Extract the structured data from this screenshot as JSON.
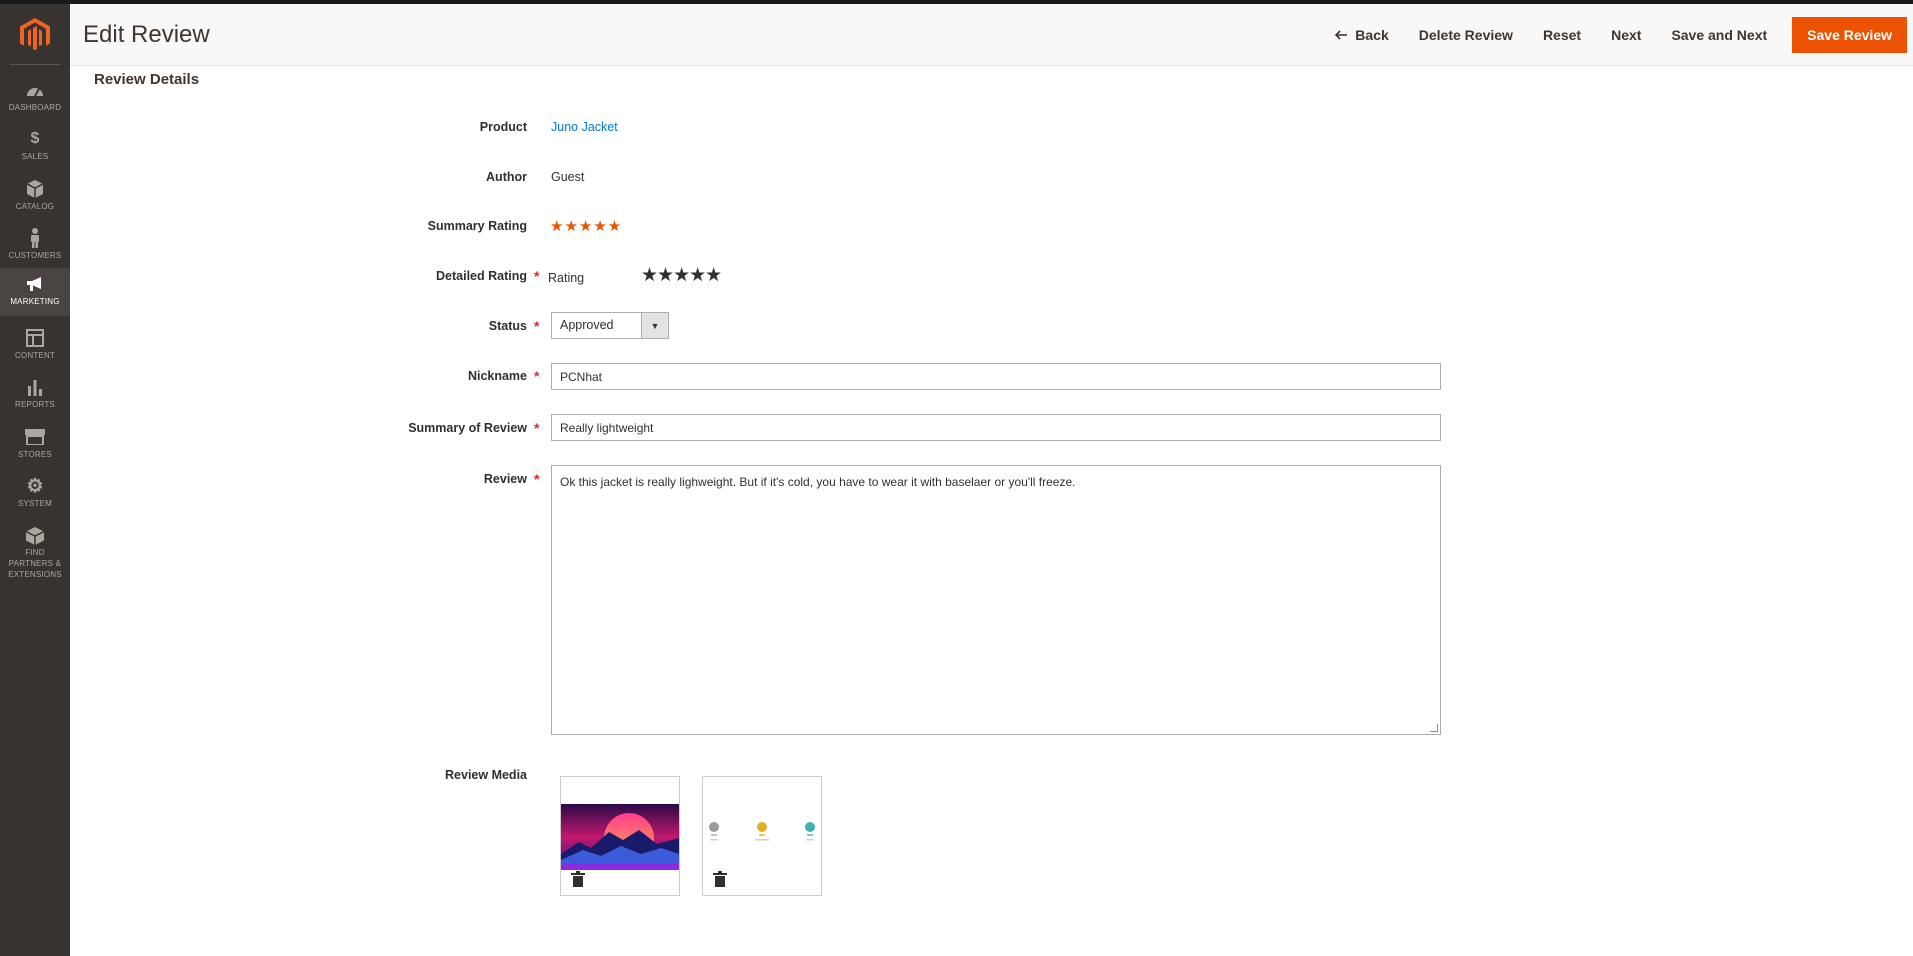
{
  "header": {
    "title": "Edit Review",
    "actions": {
      "back": "Back",
      "delete": "Delete Review",
      "reset": "Reset",
      "next": "Next",
      "save_next": "Save and Next",
      "save": "Save Review"
    }
  },
  "sidebar": {
    "items": [
      {
        "label": "DASHBOARD",
        "icon": "dashboard-icon"
      },
      {
        "label": "SALES",
        "icon": "dollar-icon"
      },
      {
        "label": "CATALOG",
        "icon": "box-icon"
      },
      {
        "label": "CUSTOMERS",
        "icon": "person-icon"
      },
      {
        "label": "MARKETING",
        "icon": "megaphone-icon"
      },
      {
        "label": "CONTENT",
        "icon": "layout-icon"
      },
      {
        "label": "REPORTS",
        "icon": "bar-chart-icon"
      },
      {
        "label": "STORES",
        "icon": "store-icon"
      },
      {
        "label": "SYSTEM",
        "icon": "gear-icon"
      },
      {
        "label": "FIND PARTNERS & EXTENSIONS",
        "icon": "cube-icon"
      }
    ],
    "active": "MARKETING"
  },
  "form": {
    "section_title": "Review Details",
    "product_label": "Product",
    "product_value": "Juno Jacket",
    "author_label": "Author",
    "author_value": "Guest",
    "summary_rating_label": "Summary Rating",
    "summary_rating_stars": 5,
    "detailed_rating_label": "Detailed Rating",
    "rating_sub_label": "Rating",
    "detailed_rating_stars": 5,
    "status_label": "Status",
    "status_value": "Approved",
    "nickname_label": "Nickname",
    "nickname_value": "PCNhat",
    "summary_label": "Summary of Review",
    "summary_value": "Really lightweight",
    "review_label": "Review",
    "review_value": "Ok this jacket is really lighweight. But if it's cold, you have to wear it with baselaer or you'll freeze.",
    "media_label": "Review Media"
  },
  "colors": {
    "accent": "#eb5202",
    "sidebar": "#373330",
    "link": "#007bdb"
  }
}
